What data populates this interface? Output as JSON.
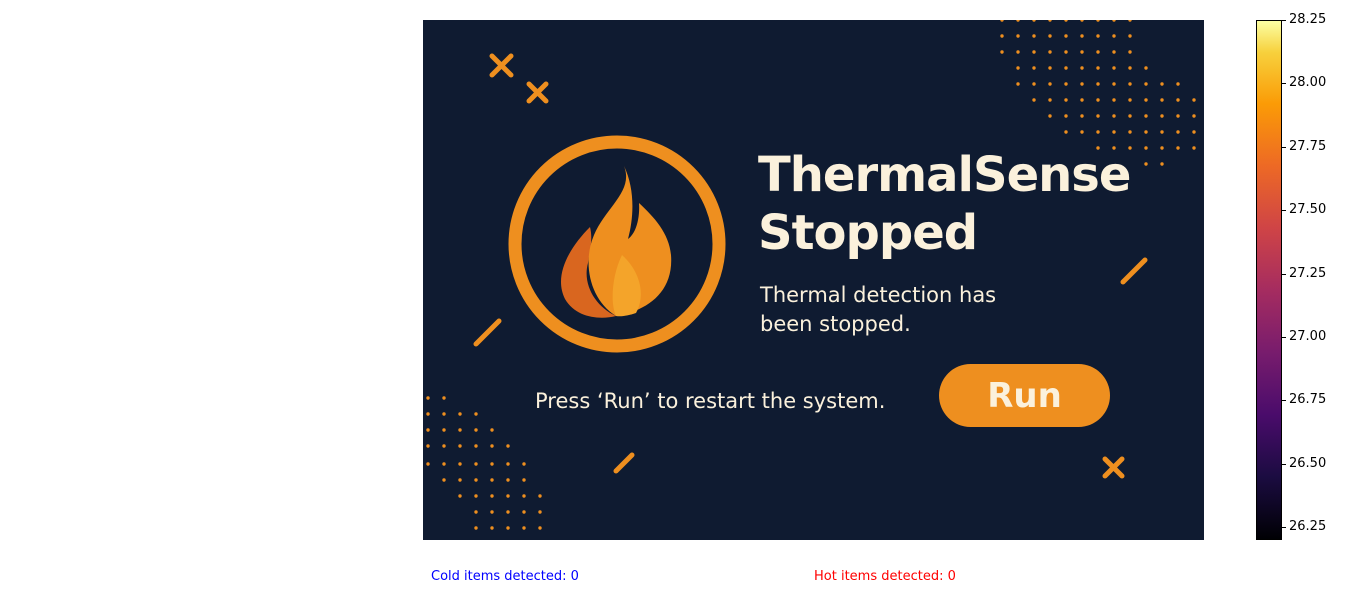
{
  "screen": {
    "title_line1": "ThermalSense",
    "title_line2": "Stopped",
    "subtitle_line1": "Thermal detection has",
    "subtitle_line2": "been stopped.",
    "hint": "Press ‘Run’ to restart the system.",
    "run_label": "Run"
  },
  "icons": {
    "logo": "flame-icon",
    "decor_cross": "cross-icon"
  },
  "colors": {
    "panel_bg": "#0f1b31",
    "accent": "#ee8f1f",
    "text": "#fbf1dc"
  },
  "colorbar": {
    "colormap": "inferno",
    "min": 26.2,
    "max": 28.25,
    "tick_labels": [
      "28.25",
      "28.00",
      "27.75",
      "27.50",
      "27.25",
      "27.00",
      "26.75",
      "26.50",
      "26.25"
    ]
  },
  "status": {
    "cold": "Cold items detected: 0",
    "hot": "Hot items detected: 0"
  }
}
